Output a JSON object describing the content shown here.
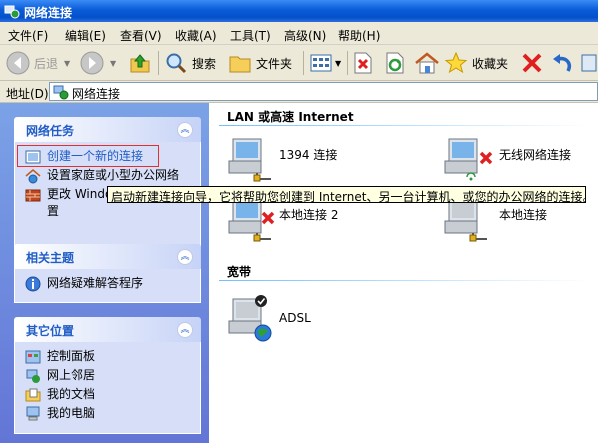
{
  "window": {
    "title": "网络连接"
  },
  "menu": [
    "文件(F)",
    "编辑(E)",
    "查看(V)",
    "收藏(A)",
    "工具(T)",
    "高级(N)",
    "帮助(H)"
  ],
  "toolbar": {
    "back": "后退",
    "search": "搜索",
    "folders": "文件夹",
    "favorites": "收藏夹"
  },
  "address": {
    "label": "地址(D)",
    "value": "网络连接"
  },
  "panels": {
    "tasks": {
      "title": "网络任务",
      "items": [
        "创建一个新的连接",
        "设置家庭或小型办公网络",
        "更改 Windows 防火墙设",
        "置"
      ]
    },
    "related": {
      "title": "相关主题",
      "items": [
        "网络疑难解答程序"
      ]
    },
    "places": {
      "title": "其它位置",
      "items": [
        "控制面板",
        "网上邻居",
        "我的文档",
        "我的电脑"
      ]
    }
  },
  "groups": {
    "lan": {
      "title": "LAN 或高速 Internet"
    },
    "broadband": {
      "title": "宽带"
    }
  },
  "connections": {
    "c1394": "1394 连接",
    "wireless": "无线网络连接",
    "local2": "本地连接 2",
    "local": "本地连接",
    "adsl": "ADSL"
  },
  "tooltip": "启动新建连接向导，它将帮助您创建到 Internet、另一台计算机、或您的办公网络的连接。",
  "colors": {
    "title_bar": "#0a5bd8",
    "task_pane": "#6f8ee0",
    "link": "#215dc6",
    "error": "#e02020"
  }
}
